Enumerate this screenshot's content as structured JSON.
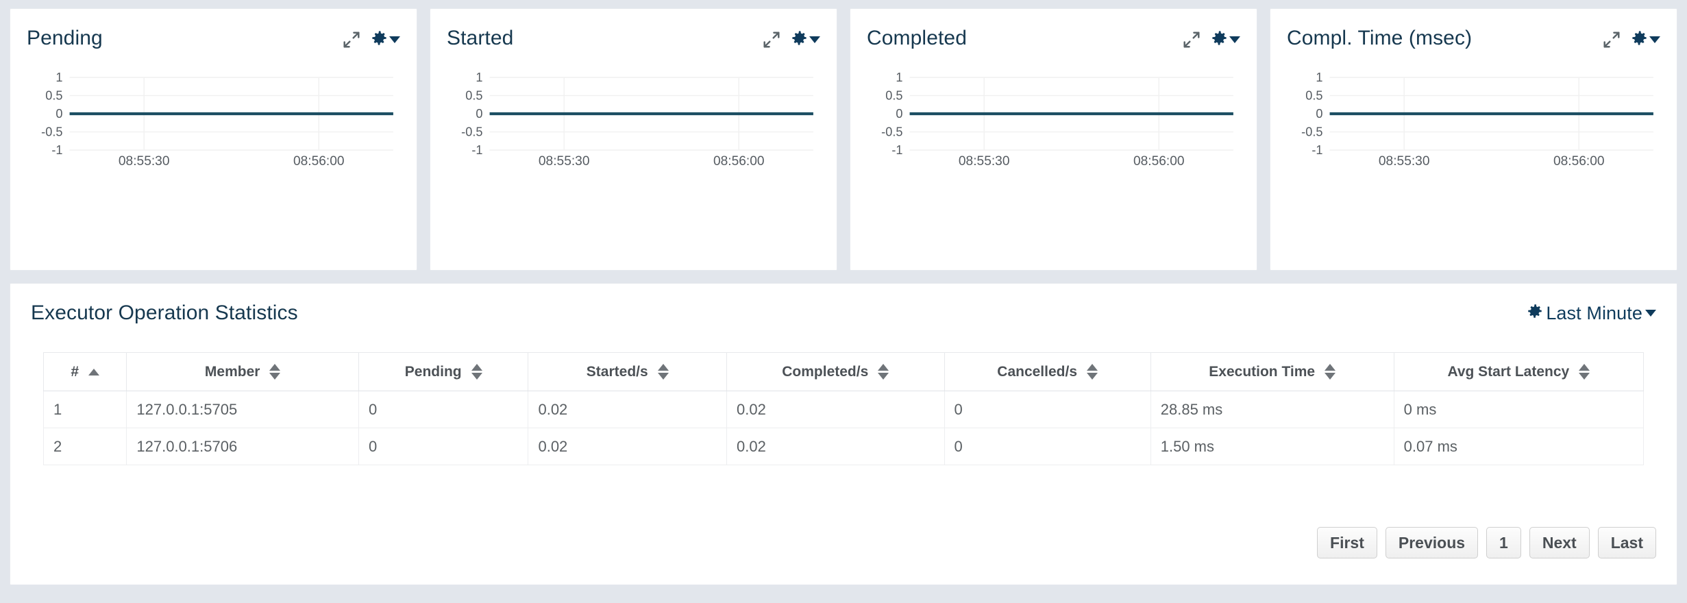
{
  "theme": {
    "page_bg": "#e2e6ec",
    "card_bg": "#ffffff",
    "title_color": "#16384f",
    "series_color": "#1d4f63",
    "grid_color": "#f1f1f1",
    "tick_color": "#555b61"
  },
  "charts": [
    {
      "title": "Pending",
      "expand_icon": "expand-arrows-icon",
      "settings_icon": "gear-icon",
      "chart_data": {
        "type": "line",
        "title": "Pending",
        "xlabel": "",
        "ylabel": "",
        "ylim": [
          -1,
          1
        ],
        "yticks": [
          "1",
          "0.5",
          "0",
          "-0.5",
          "-1"
        ],
        "xticks": [
          "08:55:30",
          "08:56:00"
        ],
        "grid": true,
        "legend": "none",
        "series": [
          {
            "name": "Pending",
            "color": "#1d4f63",
            "x": [
              "08:55:20",
              "08:55:30",
              "08:55:40",
              "08:55:50",
              "08:56:00",
              "08:56:05"
            ],
            "values": [
              0,
              0,
              0,
              0,
              0,
              0
            ]
          }
        ]
      }
    },
    {
      "title": "Started",
      "expand_icon": "expand-arrows-icon",
      "settings_icon": "gear-icon",
      "chart_data": {
        "type": "line",
        "title": "Started",
        "xlabel": "",
        "ylabel": "",
        "ylim": [
          -1,
          1
        ],
        "yticks": [
          "1",
          "0.5",
          "0",
          "-0.5",
          "-1"
        ],
        "xticks": [
          "08:55:30",
          "08:56:00"
        ],
        "grid": true,
        "legend": "none",
        "series": [
          {
            "name": "Started",
            "color": "#1d4f63",
            "x": [
              "08:55:20",
              "08:55:30",
              "08:55:40",
              "08:55:50",
              "08:56:00",
              "08:56:05"
            ],
            "values": [
              0,
              0,
              0,
              0,
              0,
              0
            ]
          }
        ]
      }
    },
    {
      "title": "Completed",
      "expand_icon": "expand-arrows-icon",
      "settings_icon": "gear-icon",
      "chart_data": {
        "type": "line",
        "title": "Completed",
        "xlabel": "",
        "ylabel": "",
        "ylim": [
          -1,
          1
        ],
        "yticks": [
          "1",
          "0.5",
          "0",
          "-0.5",
          "-1"
        ],
        "xticks": [
          "08:55:30",
          "08:56:00"
        ],
        "grid": true,
        "legend": "none",
        "series": [
          {
            "name": "Completed",
            "color": "#1d4f63",
            "x": [
              "08:55:20",
              "08:55:30",
              "08:55:40",
              "08:55:50",
              "08:56:00",
              "08:56:05"
            ],
            "values": [
              0,
              0,
              0,
              0,
              0,
              0
            ]
          }
        ]
      }
    },
    {
      "title": "Compl. Time (msec)",
      "expand_icon": "expand-arrows-icon",
      "settings_icon": "gear-icon",
      "chart_data": {
        "type": "line",
        "title": "Compl. Time (msec)",
        "xlabel": "",
        "ylabel": "",
        "ylim": [
          -1,
          1
        ],
        "yticks": [
          "1",
          "0.5",
          "0",
          "-0.5",
          "-1"
        ],
        "xticks": [
          "08:55:30",
          "08:56:00"
        ],
        "grid": true,
        "legend": "none",
        "series": [
          {
            "name": "Compl. Time (msec)",
            "color": "#1d4f63",
            "x": [
              "08:55:20",
              "08:55:30",
              "08:55:40",
              "08:55:50",
              "08:56:00",
              "08:56:05"
            ],
            "values": [
              0,
              0,
              0,
              0,
              0,
              0
            ]
          }
        ]
      }
    }
  ],
  "stats_panel": {
    "title": "Executor Operation Statistics",
    "range_selector": {
      "icon": "gear-icon",
      "label": "Last Minute",
      "caret": "chevron-down-icon"
    },
    "table": {
      "columns": [
        {
          "label": "#",
          "sort": "asc"
        },
        {
          "label": "Member",
          "sort": "none"
        },
        {
          "label": "Pending",
          "sort": "none"
        },
        {
          "label": "Started/s",
          "sort": "none"
        },
        {
          "label": "Completed/s",
          "sort": "none"
        },
        {
          "label": "Cancelled/s",
          "sort": "none"
        },
        {
          "label": "Execution Time",
          "sort": "none"
        },
        {
          "label": "Avg Start Latency",
          "sort": "none"
        }
      ],
      "rows": [
        [
          "1",
          "127.0.0.1:5705",
          "0",
          "0.02",
          "0.02",
          "0",
          "28.85 ms",
          "0 ms"
        ],
        [
          "2",
          "127.0.0.1:5706",
          "0",
          "0.02",
          "0.02",
          "0",
          "1.50 ms",
          "0.07 ms"
        ]
      ]
    },
    "pagination": {
      "first": "First",
      "previous": "Previous",
      "current_page": "1",
      "next": "Next",
      "last": "Last"
    }
  }
}
